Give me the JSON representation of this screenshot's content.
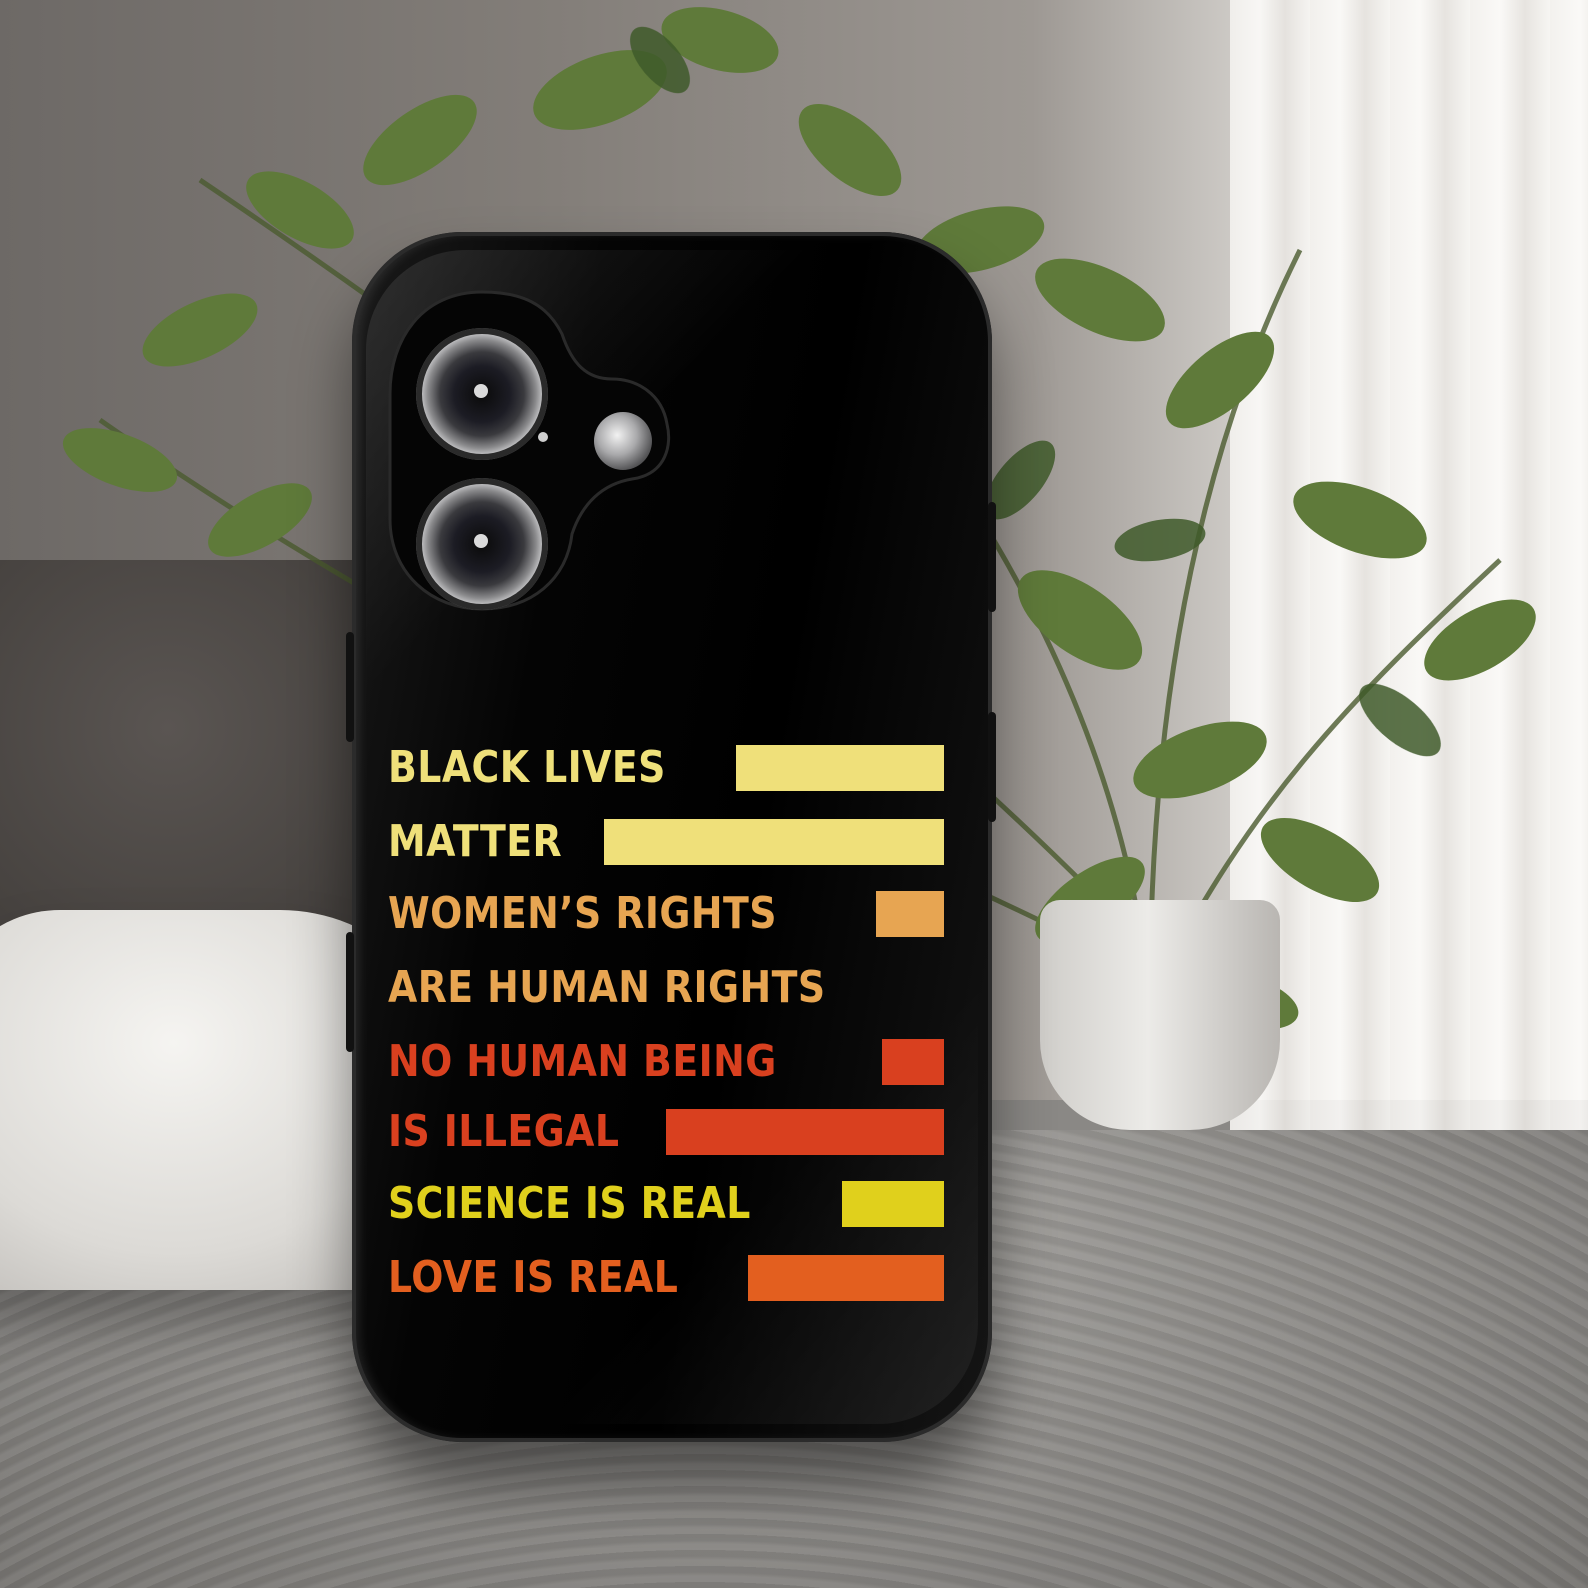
{
  "scene": {
    "subject": "phone-case-product-photo"
  },
  "phone_case": {
    "background_color": "#000000",
    "slogan": [
      {
        "text": "BLACK LIVES",
        "color": "#efe07a"
      },
      {
        "text": "MATTER",
        "color": "#efe07a"
      },
      {
        "text": "WOMEN’S RIGHTS",
        "color": "#e7a552"
      },
      {
        "text": "ARE HUMAN RIGHTS",
        "color": "#e7a552"
      },
      {
        "text": "NO HUMAN BEING",
        "color": "#d9401f"
      },
      {
        "text": "IS ILLEGAL",
        "color": "#d9401f"
      },
      {
        "text": "SCIENCE IS REAL",
        "color": "#e0d01c"
      },
      {
        "text": "LOVE IS REAL",
        "color": "#e35f1f"
      }
    ]
  }
}
